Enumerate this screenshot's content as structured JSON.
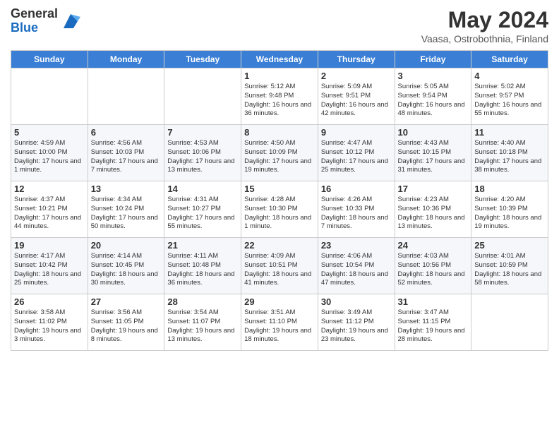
{
  "logo": {
    "general": "General",
    "blue": "Blue",
    "icon_title": "GeneralBlue logo"
  },
  "header": {
    "month_title": "May 2024",
    "subtitle": "Vaasa, Ostrobothnia, Finland"
  },
  "days_of_week": [
    "Sunday",
    "Monday",
    "Tuesday",
    "Wednesday",
    "Thursday",
    "Friday",
    "Saturday"
  ],
  "weeks": [
    [
      {
        "day": "",
        "info": ""
      },
      {
        "day": "",
        "info": ""
      },
      {
        "day": "",
        "info": ""
      },
      {
        "day": "1",
        "info": "Sunrise: 5:12 AM\nSunset: 9:48 PM\nDaylight: 16 hours and 36 minutes."
      },
      {
        "day": "2",
        "info": "Sunrise: 5:09 AM\nSunset: 9:51 PM\nDaylight: 16 hours and 42 minutes."
      },
      {
        "day": "3",
        "info": "Sunrise: 5:05 AM\nSunset: 9:54 PM\nDaylight: 16 hours and 48 minutes."
      },
      {
        "day": "4",
        "info": "Sunrise: 5:02 AM\nSunset: 9:57 PM\nDaylight: 16 hours and 55 minutes."
      }
    ],
    [
      {
        "day": "5",
        "info": "Sunrise: 4:59 AM\nSunset: 10:00 PM\nDaylight: 17 hours and 1 minute."
      },
      {
        "day": "6",
        "info": "Sunrise: 4:56 AM\nSunset: 10:03 PM\nDaylight: 17 hours and 7 minutes."
      },
      {
        "day": "7",
        "info": "Sunrise: 4:53 AM\nSunset: 10:06 PM\nDaylight: 17 hours and 13 minutes."
      },
      {
        "day": "8",
        "info": "Sunrise: 4:50 AM\nSunset: 10:09 PM\nDaylight: 17 hours and 19 minutes."
      },
      {
        "day": "9",
        "info": "Sunrise: 4:47 AM\nSunset: 10:12 PM\nDaylight: 17 hours and 25 minutes."
      },
      {
        "day": "10",
        "info": "Sunrise: 4:43 AM\nSunset: 10:15 PM\nDaylight: 17 hours and 31 minutes."
      },
      {
        "day": "11",
        "info": "Sunrise: 4:40 AM\nSunset: 10:18 PM\nDaylight: 17 hours and 38 minutes."
      }
    ],
    [
      {
        "day": "12",
        "info": "Sunrise: 4:37 AM\nSunset: 10:21 PM\nDaylight: 17 hours and 44 minutes."
      },
      {
        "day": "13",
        "info": "Sunrise: 4:34 AM\nSunset: 10:24 PM\nDaylight: 17 hours and 50 minutes."
      },
      {
        "day": "14",
        "info": "Sunrise: 4:31 AM\nSunset: 10:27 PM\nDaylight: 17 hours and 55 minutes."
      },
      {
        "day": "15",
        "info": "Sunrise: 4:28 AM\nSunset: 10:30 PM\nDaylight: 18 hours and 1 minute."
      },
      {
        "day": "16",
        "info": "Sunrise: 4:26 AM\nSunset: 10:33 PM\nDaylight: 18 hours and 7 minutes."
      },
      {
        "day": "17",
        "info": "Sunrise: 4:23 AM\nSunset: 10:36 PM\nDaylight: 18 hours and 13 minutes."
      },
      {
        "day": "18",
        "info": "Sunrise: 4:20 AM\nSunset: 10:39 PM\nDaylight: 18 hours and 19 minutes."
      }
    ],
    [
      {
        "day": "19",
        "info": "Sunrise: 4:17 AM\nSunset: 10:42 PM\nDaylight: 18 hours and 25 minutes."
      },
      {
        "day": "20",
        "info": "Sunrise: 4:14 AM\nSunset: 10:45 PM\nDaylight: 18 hours and 30 minutes."
      },
      {
        "day": "21",
        "info": "Sunrise: 4:11 AM\nSunset: 10:48 PM\nDaylight: 18 hours and 36 minutes."
      },
      {
        "day": "22",
        "info": "Sunrise: 4:09 AM\nSunset: 10:51 PM\nDaylight: 18 hours and 41 minutes."
      },
      {
        "day": "23",
        "info": "Sunrise: 4:06 AM\nSunset: 10:54 PM\nDaylight: 18 hours and 47 minutes."
      },
      {
        "day": "24",
        "info": "Sunrise: 4:03 AM\nSunset: 10:56 PM\nDaylight: 18 hours and 52 minutes."
      },
      {
        "day": "25",
        "info": "Sunrise: 4:01 AM\nSunset: 10:59 PM\nDaylight: 18 hours and 58 minutes."
      }
    ],
    [
      {
        "day": "26",
        "info": "Sunrise: 3:58 AM\nSunset: 11:02 PM\nDaylight: 19 hours and 3 minutes."
      },
      {
        "day": "27",
        "info": "Sunrise: 3:56 AM\nSunset: 11:05 PM\nDaylight: 19 hours and 8 minutes."
      },
      {
        "day": "28",
        "info": "Sunrise: 3:54 AM\nSunset: 11:07 PM\nDaylight: 19 hours and 13 minutes."
      },
      {
        "day": "29",
        "info": "Sunrise: 3:51 AM\nSunset: 11:10 PM\nDaylight: 19 hours and 18 minutes."
      },
      {
        "day": "30",
        "info": "Sunrise: 3:49 AM\nSunset: 11:12 PM\nDaylight: 19 hours and 23 minutes."
      },
      {
        "day": "31",
        "info": "Sunrise: 3:47 AM\nSunset: 11:15 PM\nDaylight: 19 hours and 28 minutes."
      },
      {
        "day": "",
        "info": ""
      }
    ]
  ]
}
